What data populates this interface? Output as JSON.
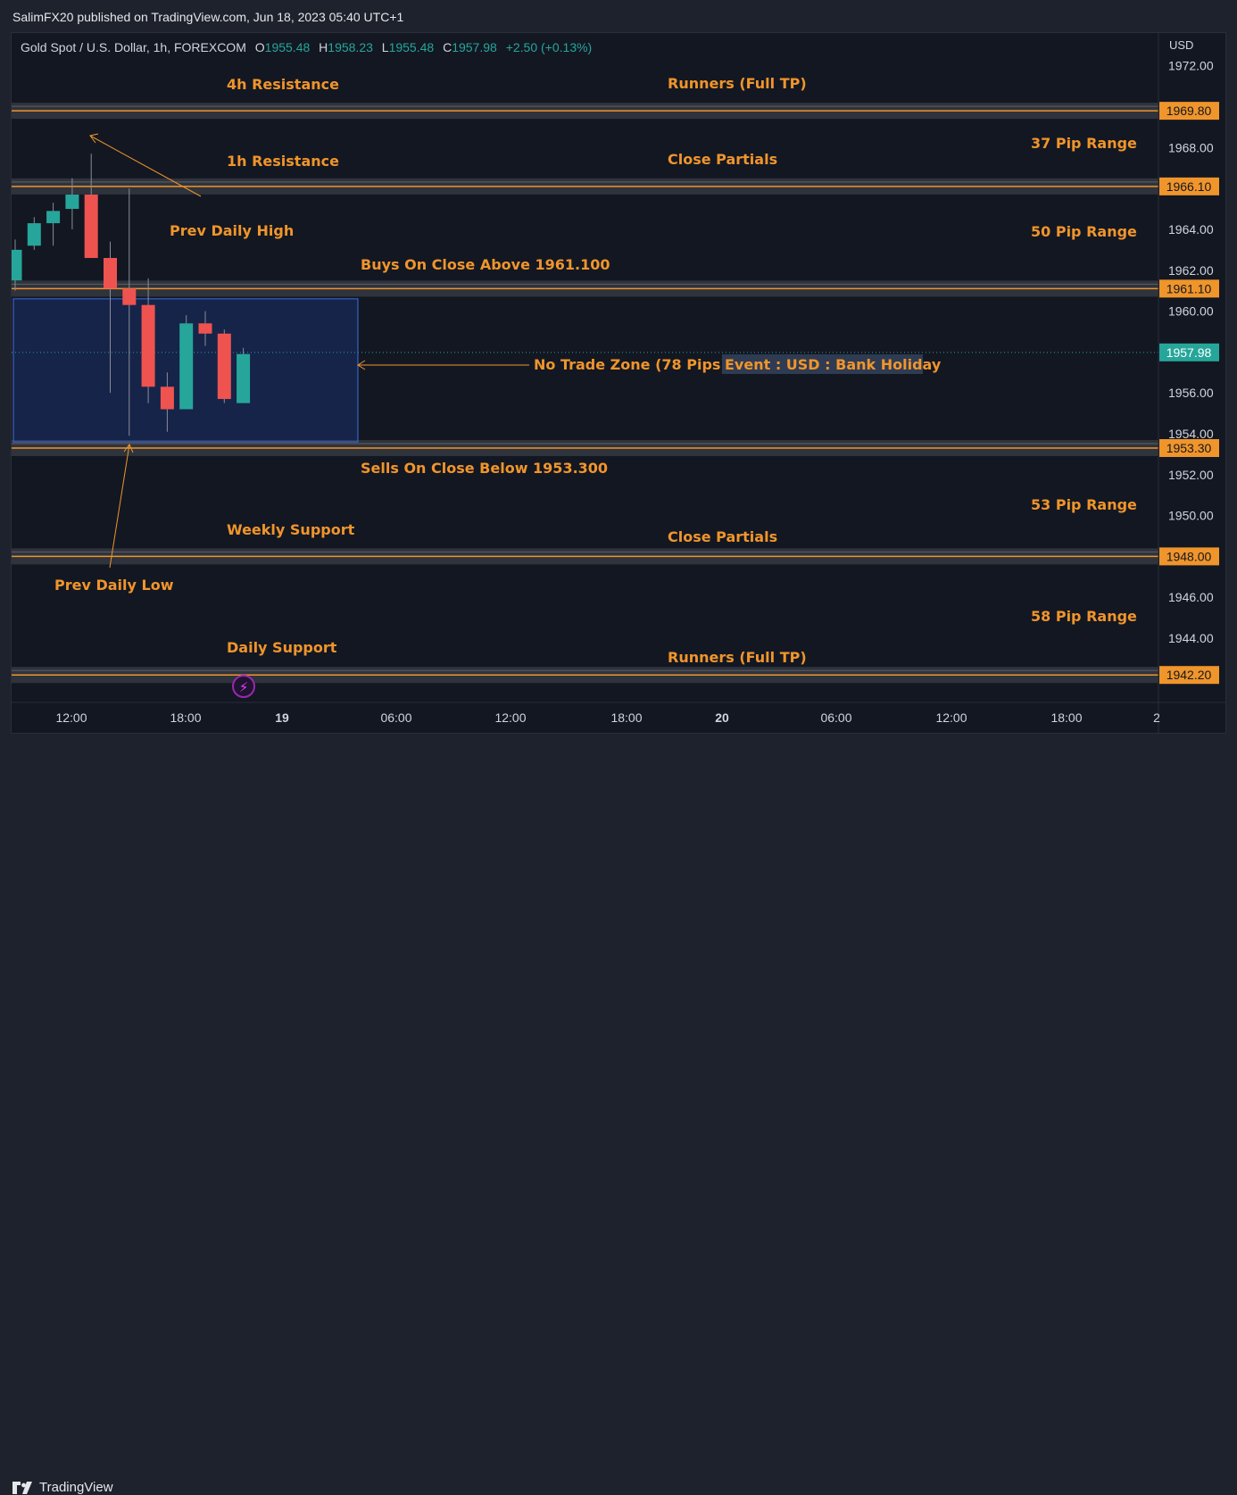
{
  "header": {
    "publisher": "SalimFX20 published on TradingView.com, Jun 18, 2023 05:40 UTC+1"
  },
  "legend": {
    "symbol": "Gold Spot / U.S. Dollar, 1h, FOREXCOM",
    "o_key": "O",
    "o": "1955.48",
    "h_key": "H",
    "h": "1958.23",
    "l_key": "L",
    "l": "1955.48",
    "c_key": "C",
    "c": "1957.98",
    "change": "+2.50 (+0.13%)"
  },
  "axis": {
    "currency": "USD"
  },
  "footer": {
    "brand": "TradingView"
  },
  "colors": {
    "up": "#26a69a",
    "down": "#ef5350",
    "level": "#f0952b",
    "band": "#3a3d46",
    "zone": "#2962ff"
  },
  "chart_data": {
    "type": "candlestick",
    "ylim": [
      1940.9,
      1972.6
    ],
    "y_ticks": [
      "1972.00",
      "1968.00",
      "1964.00",
      "1962.00",
      "1960.00",
      "1956.00",
      "1954.00",
      "1952.00",
      "1950.00",
      "1946.00",
      "1944.00"
    ],
    "x_ticks": [
      "12:00",
      "18:00",
      "19",
      "06:00",
      "12:00",
      "18:00",
      "20",
      "06:00",
      "12:00",
      "18:00",
      "2"
    ],
    "candles": [
      {
        "o": 1961.5,
        "h": 1963.5,
        "l": 1961.0,
        "c": 1963.0
      },
      {
        "o": 1963.2,
        "h": 1964.6,
        "l": 1963.0,
        "c": 1964.3
      },
      {
        "o": 1964.3,
        "h": 1965.3,
        "l": 1963.2,
        "c": 1964.9
      },
      {
        "o": 1965.0,
        "h": 1966.5,
        "l": 1964.0,
        "c": 1965.7
      },
      {
        "o": 1965.7,
        "h": 1967.7,
        "l": 1962.6,
        "c": 1962.6
      },
      {
        "o": 1962.6,
        "h": 1963.4,
        "l": 1956.0,
        "c": 1961.1
      },
      {
        "o": 1961.1,
        "h": 1966.0,
        "l": 1953.9,
        "c": 1960.3
      },
      {
        "o": 1960.3,
        "h": 1961.6,
        "l": 1955.5,
        "c": 1956.3
      },
      {
        "o": 1956.3,
        "h": 1957.0,
        "l": 1954.1,
        "c": 1955.2
      },
      {
        "o": 1955.2,
        "h": 1959.8,
        "l": 1955.2,
        "c": 1959.4
      },
      {
        "o": 1959.4,
        "h": 1960.0,
        "l": 1958.3,
        "c": 1958.9
      },
      {
        "o": 1958.9,
        "h": 1959.1,
        "l": 1955.5,
        "c": 1955.7
      },
      {
        "o": 1955.5,
        "h": 1958.2,
        "l": 1955.5,
        "c": 1957.9
      }
    ],
    "levels": [
      {
        "price": 1969.8,
        "label": "1969.80"
      },
      {
        "price": 1966.1,
        "label": "1966.10"
      },
      {
        "price": 1961.1,
        "label": "1961.10"
      },
      {
        "price": 1953.3,
        "label": "1953.30"
      },
      {
        "price": 1948.0,
        "label": "1948.00"
      },
      {
        "price": 1942.2,
        "label": "1942.20"
      }
    ],
    "current_price": {
      "price": 1957.98,
      "label": "1957.98"
    },
    "no_trade_zone": {
      "top": 1960.6,
      "bottom": 1953.6
    },
    "annotations": {
      "res_4h": "4h Resistance",
      "runners_top": "Runners (Full TP)",
      "range_37": "37 Pip Range",
      "res_1h": "1h Resistance",
      "close_partials_top": "Close Partials",
      "prev_daily_high": "Prev Daily High",
      "range_50": "50 Pip Range",
      "buys": "Buys On Close Above 1961.100",
      "no_trade": "No Trade Zone (78 Pips)",
      "event": "Event : USD : Bank Holiday",
      "sells": "Sells On Close Below 1953.300",
      "range_53": "53 Pip Range",
      "weekly_support": "Weekly Support",
      "close_partials_bottom": "Close Partials",
      "prev_daily_low": "Prev Daily Low",
      "range_58": "58 Pip Range",
      "daily_support": "Daily Support",
      "runners_bottom": "Runners (Full TP)"
    }
  }
}
